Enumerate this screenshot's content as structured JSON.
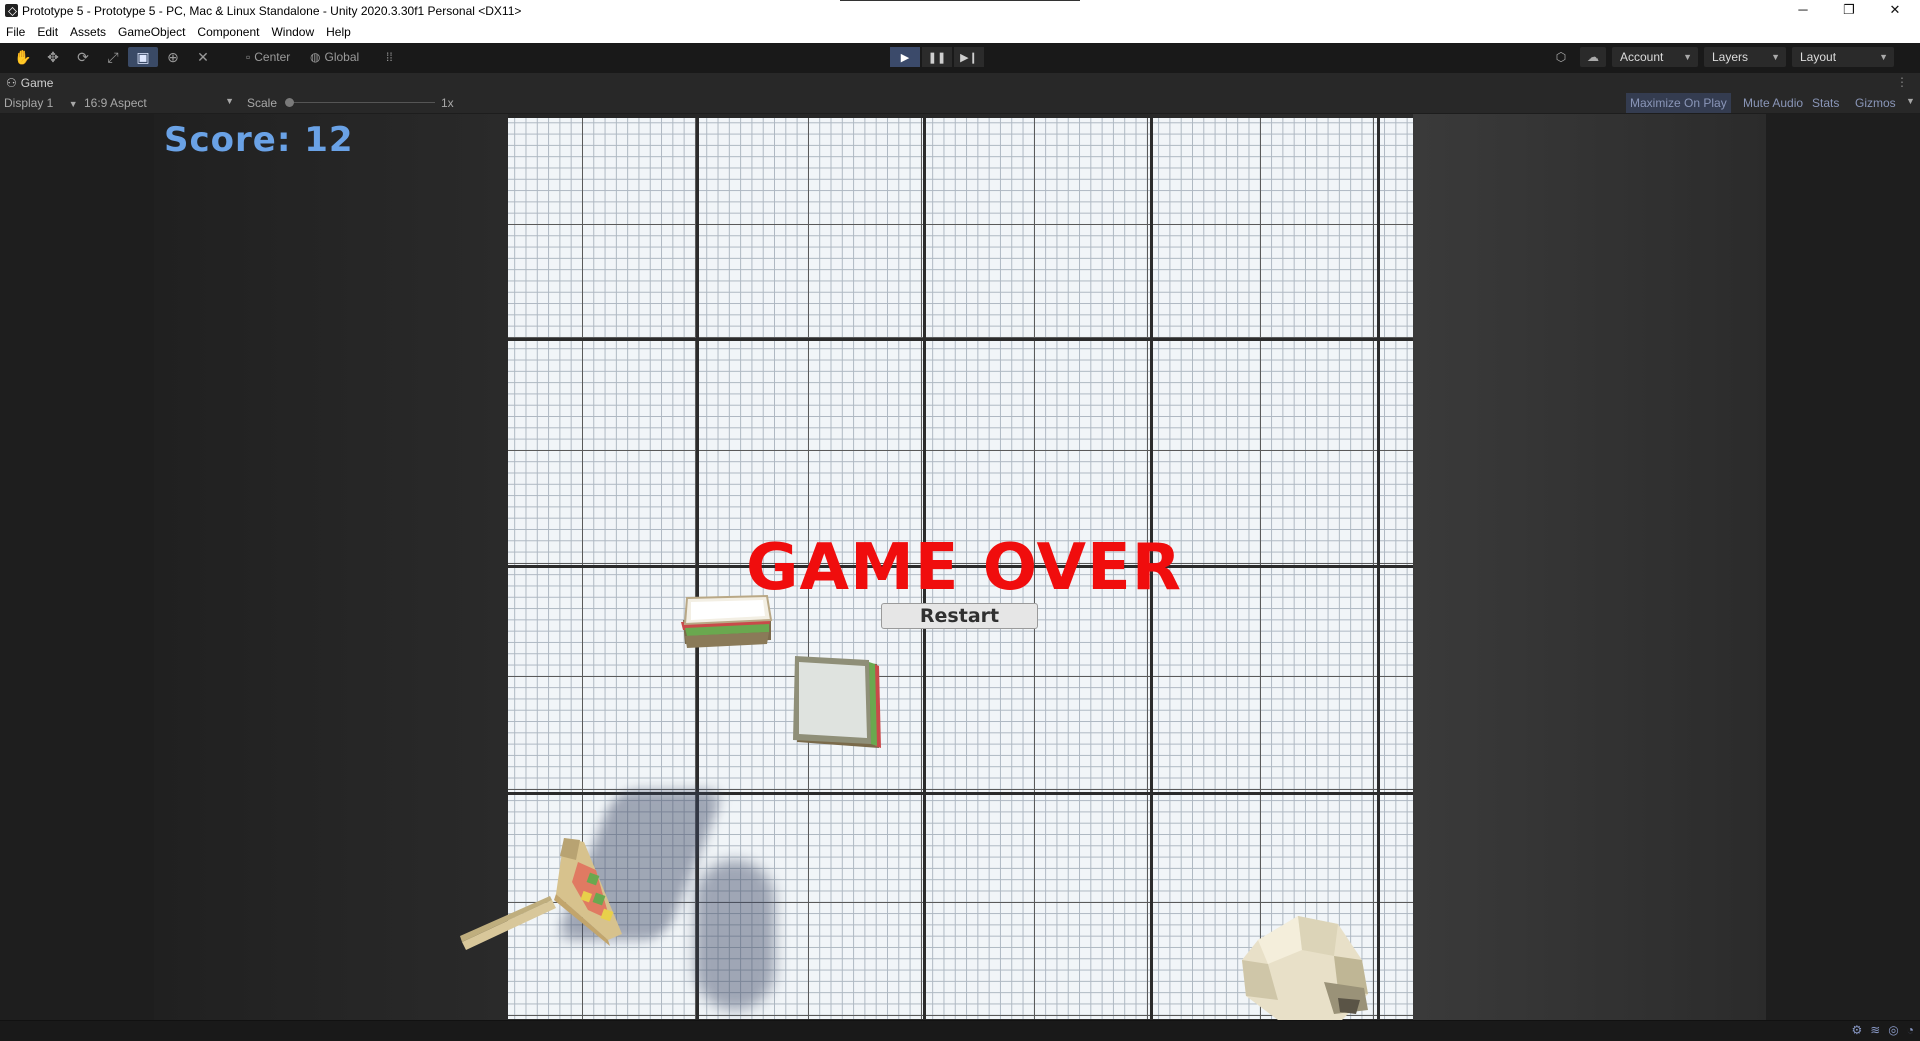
{
  "window": {
    "title": "Prototype 5 - Prototype 5 - PC, Mac & Linux Standalone - Unity 2020.3.30f1 Personal <DX11>",
    "minimize": "─",
    "maximize": "❐",
    "close": "✕"
  },
  "menu": [
    "File",
    "Edit",
    "Assets",
    "GameObject",
    "Component",
    "Window",
    "Help"
  ],
  "toolbar": {
    "tools": [
      "hand-tool-icon",
      "move-tool-icon",
      "rotate-tool-icon",
      "scale-tool-icon",
      "rect-tool-icon",
      "transform-tool-icon",
      "custom-tool-icon"
    ],
    "pivot_mode": "Center",
    "pivot_rotation": "Global",
    "account_label": "Account",
    "layers_label": "Layers",
    "layout_label": "Layout"
  },
  "game_tab": {
    "label": "Game",
    "display": "Display 1",
    "aspect": "16:9 Aspect",
    "scale_label": "Scale",
    "scale_value": "1x",
    "maximize_on_play": "Maximize On Play",
    "mute_audio": "Mute Audio",
    "stats": "Stats",
    "gizmos": "Gizmos"
  },
  "game": {
    "score_text": "Score: 12",
    "game_over_text": "GAME OVER",
    "restart_label": "Restart"
  },
  "colors": {
    "score": "#6aa2e6",
    "game_over": "#f00d0d",
    "play_active": "#3b4a6a"
  }
}
